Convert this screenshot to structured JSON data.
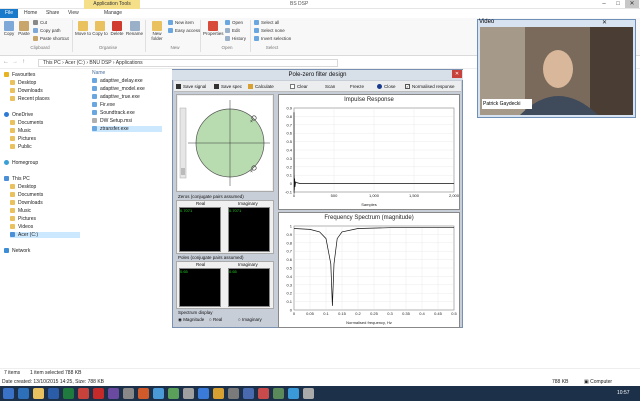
{
  "explorer": {
    "contextual_tab": "Application Tools",
    "title": "BS DSP",
    "tabs": [
      "File",
      "Home",
      "Share",
      "View",
      "Manage"
    ],
    "ribbon": {
      "copy": "Copy",
      "paste": "Paste",
      "cut": "Cut",
      "copy_path": "Copy path",
      "paste_shortcut": "Paste shortcut",
      "move_to": "Move to",
      "copy_to": "Copy to",
      "delete": "Delete",
      "rename": "Rename",
      "new_folder": "New folder",
      "new_item": "New item",
      "easy_access": "Easy access",
      "properties": "Properties",
      "open": "Open",
      "edit": "Edit",
      "history": "History",
      "select_all": "Select all",
      "select_none": "Select none",
      "invert_selection": "Invert selection",
      "groups": [
        "Clipboard",
        "Organise",
        "New",
        "Open",
        "Select"
      ]
    },
    "address": [
      "This PC",
      "Acer (C:)",
      "BNU DSP",
      "Applications"
    ],
    "nav": {
      "favourites": "Favourites",
      "fav_items": [
        "Desktop",
        "Downloads",
        "Recent places"
      ],
      "onedrive": "OneDrive",
      "onedrive_items": [
        "Documents",
        "Music",
        "Pictures",
        "Public"
      ],
      "homegroup": "Homegroup",
      "thispc": "This PC",
      "pc_items": [
        "Desktop",
        "Documents",
        "Downloads",
        "Music",
        "Pictures",
        "Videos",
        "Acer (C:)"
      ],
      "network": "Network"
    },
    "list_header": "Name",
    "files": [
      "adaptive_delay.exe",
      "adaptive_model.exe",
      "adaptive_true.exe",
      "Fir.exe",
      "Soundtrack.exe",
      "DW Setup.msi",
      "ztransfer.exe"
    ],
    "status": {
      "items": "7 items",
      "selected": "1 item selected  788 KB",
      "details": "Date created: 13/10/2015 14:25, Size: 788 KB",
      "size_right": "788 KB",
      "computer": "Computer"
    }
  },
  "video": {
    "title": "Video",
    "name_caption": "Patrick Gaydecki"
  },
  "pz": {
    "title": "Pole-zero filter design",
    "toolbar": [
      "Save signal",
      "Save spec",
      "Calculate",
      "Clear",
      "Scan",
      "Freeze",
      "Close"
    ],
    "normalised": "Normalised response",
    "zeros_title": "Zeros (conjugate pairs assumed)",
    "poles_title": "Poles (conjugate pairs assumed)",
    "real": "Real",
    "imaginary": "Imaginary",
    "zero_real": "0.7071",
    "zero_imag": "0.7071",
    "pole_real": "0.65",
    "pole_imag": "0.65",
    "spectrum_display": "Spectrum display",
    "opt_magnitude": "Magnitude",
    "opt_real": "Real",
    "opt_imaginary": "Imaginary",
    "impulse_title": "Impulse Response",
    "impulse_xlabel": "Samples",
    "freq_title": "Frequency Spectrum (magnitude)",
    "freq_xlabel": "Normalised frequency, Hz"
  },
  "taskbar": {
    "time": "10:57"
  },
  "chart_data": [
    {
      "type": "line",
      "title": "Impulse Response",
      "xlabel": "Samples",
      "ylabel": "",
      "xlim": [
        0,
        2000
      ],
      "ylim": [
        -0.1,
        0.9
      ],
      "x_ticks": [
        "0",
        "500",
        "1,000",
        "1,500",
        "2,000"
      ],
      "y_ticks": [
        "0.9",
        "0.8",
        "0.7",
        "0.6",
        "0.5",
        "0.4",
        "0.3",
        "0.2",
        "0.1",
        "0",
        "-0.1"
      ],
      "series": [
        {
          "x": [
            0,
            1,
            2,
            4,
            8,
            12,
            20,
            40,
            80,
            2000
          ],
          "y": [
            0.85,
            -0.12,
            0.1,
            -0.08,
            0.06,
            -0.04,
            0.02,
            0.01,
            0,
            0
          ]
        }
      ]
    },
    {
      "type": "line",
      "title": "Frequency Spectrum (magnitude)",
      "xlabel": "Normalised frequency, Hz",
      "ylabel": "",
      "xlim": [
        0,
        0.5
      ],
      "ylim": [
        0,
        1
      ],
      "x_ticks": [
        "0",
        "0.05",
        "0.1",
        "0.15",
        "0.2",
        "0.25",
        "0.3",
        "0.35",
        "0.4",
        "0.45",
        "0.5"
      ],
      "y_ticks": [
        "1",
        "0.9",
        "0.8",
        "0.7",
        "0.6",
        "0.5",
        "0.4",
        "0.3",
        "0.2",
        "0.1",
        "0"
      ],
      "series": [
        {
          "x": [
            0,
            0.05,
            0.08,
            0.1,
            0.115,
            0.12,
            0.125,
            0.135,
            0.15,
            0.2,
            0.3,
            0.4,
            0.5
          ],
          "y": [
            0.97,
            0.96,
            0.93,
            0.85,
            0.55,
            0.05,
            0.55,
            0.85,
            0.93,
            0.97,
            0.98,
            0.98,
            0.98
          ]
        }
      ]
    }
  ]
}
